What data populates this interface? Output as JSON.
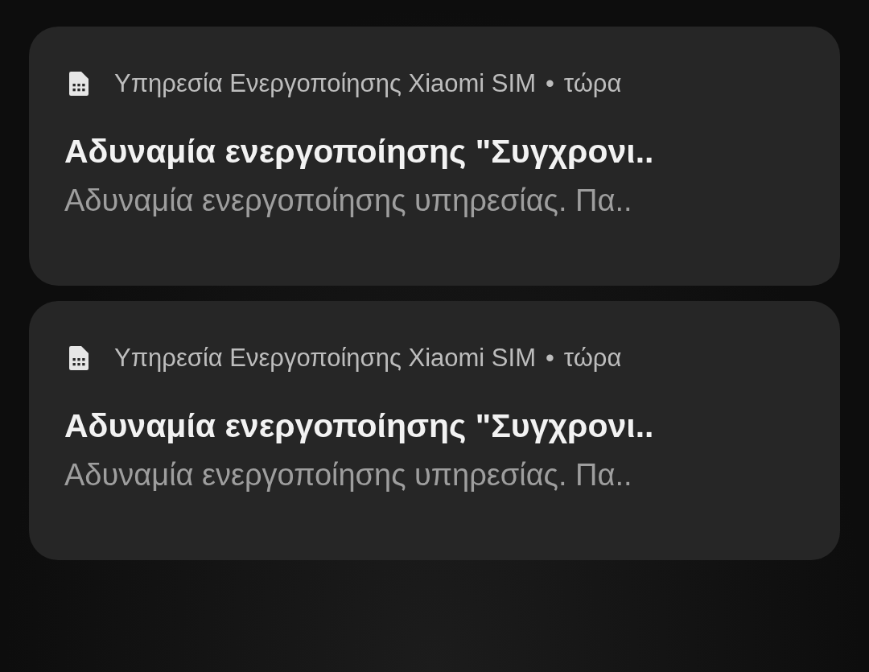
{
  "notifications": [
    {
      "app": "Υπηρεσία Ενεργοποίησης Xiaomi SIM",
      "separator": "•",
      "time": "τώρα",
      "title": "Αδυναμία ενεργοποίησης \"Συγχρονι..",
      "body": "Αδυναμία ενεργοποίησης υπηρεσίας. Πα.."
    },
    {
      "app": "Υπηρεσία Ενεργοποίησης Xiaomi SIM",
      "separator": "•",
      "time": "τώρα",
      "title": "Αδυναμία ενεργοποίησης \"Συγχρονι..",
      "body": "Αδυναμία ενεργοποίησης υπηρεσίας. Πα.."
    }
  ]
}
